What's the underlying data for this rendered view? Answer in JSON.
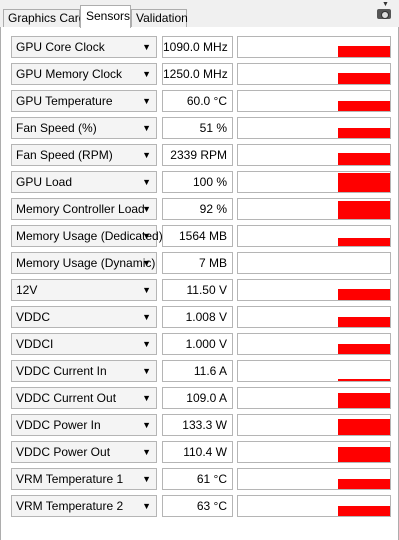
{
  "tabs": [
    {
      "label": "Graphics Card"
    },
    {
      "label": "Sensors"
    },
    {
      "label": "Validation"
    }
  ],
  "sensors": [
    {
      "name": "GPU Core Clock",
      "value": "1090.0 MHz",
      "level": 0.55
    },
    {
      "name": "GPU Memory Clock",
      "value": "1250.0 MHz",
      "level": 0.55
    },
    {
      "name": "GPU Temperature",
      "value": "60.0 °C",
      "level": 0.5
    },
    {
      "name": "Fan Speed (%)",
      "value": "51 %",
      "level": 0.5
    },
    {
      "name": "Fan Speed (RPM)",
      "value": "2339 RPM",
      "level": 0.6
    },
    {
      "name": "GPU Load",
      "value": "100 %",
      "level": 0.95
    },
    {
      "name": "Memory Controller Load",
      "value": "92 %",
      "level": 0.9
    },
    {
      "name": "Memory Usage (Dedicated)",
      "value": "1564 MB",
      "level": 0.4
    },
    {
      "name": "Memory Usage (Dynamic)",
      "value": "7 MB",
      "level": 0.0
    },
    {
      "name": "12V",
      "value": "11.50 V",
      "level": 0.55
    },
    {
      "name": "VDDC",
      "value": "1.008 V",
      "level": 0.5
    },
    {
      "name": "VDDCI",
      "value": "1.000 V",
      "level": 0.5
    },
    {
      "name": "VDDC Current In",
      "value": "11.6 A",
      "level": 0.12
    },
    {
      "name": "VDDC Current Out",
      "value": "109.0 A",
      "level": 0.75
    },
    {
      "name": "VDDC Power In",
      "value": "133.3 W",
      "level": 0.8
    },
    {
      "name": "VDDC Power Out",
      "value": "110.4 W",
      "level": 0.75
    },
    {
      "name": "VRM Temperature 1",
      "value": "61 °C",
      "level": 0.5
    },
    {
      "name": "VRM Temperature 2",
      "value": "63 °C",
      "level": 0.5
    }
  ],
  "colors": {
    "graph_bar": "#ff0000"
  },
  "icons": {
    "dropdown": "chevron-down-icon",
    "screenshot": "camera-icon",
    "menu": "menu-arrow-icon"
  }
}
